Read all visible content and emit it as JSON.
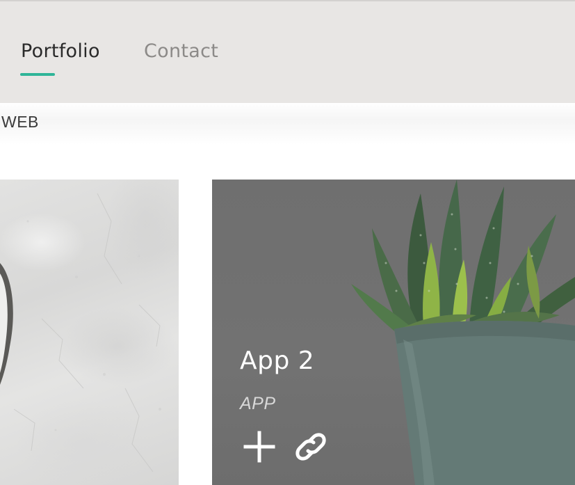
{
  "nav": {
    "tabs": [
      {
        "label": "Portfolio",
        "active": true
      },
      {
        "label": "Contact",
        "active": false
      }
    ],
    "accent_color": "#2fb598"
  },
  "filter": {
    "label": "WEB"
  },
  "portfolio": {
    "items": [
      {
        "image": "concrete-texture-with-bowl",
        "title": "",
        "category": ""
      },
      {
        "image": "succulent-in-teal-pot",
        "title": "App 2",
        "category": "APP",
        "actions": [
          {
            "icon": "plus-icon"
          },
          {
            "icon": "link-icon"
          }
        ]
      }
    ]
  }
}
